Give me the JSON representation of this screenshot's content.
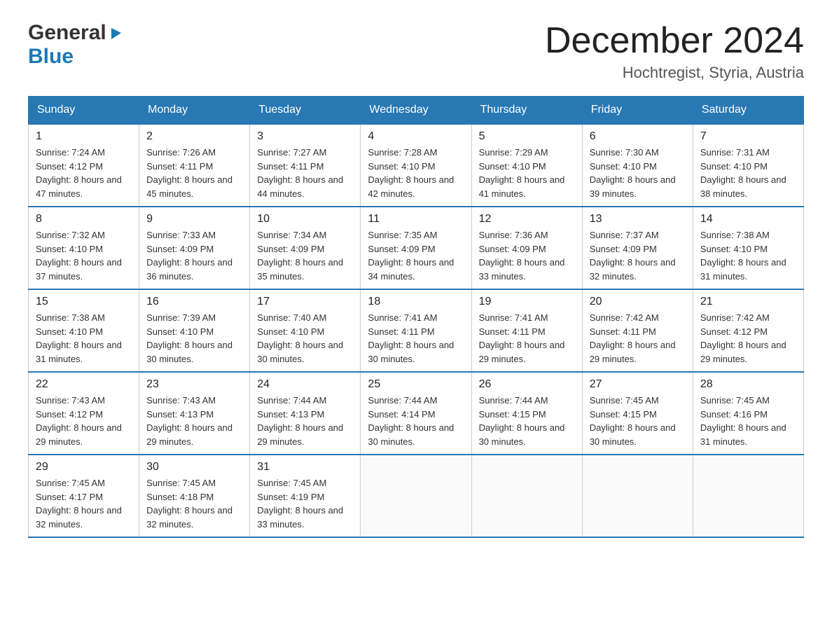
{
  "logo": {
    "general": "General",
    "blue": "Blue",
    "triangle": "▶"
  },
  "title": {
    "month": "December 2024",
    "location": "Hochtregist, Styria, Austria"
  },
  "weekdays": [
    "Sunday",
    "Monday",
    "Tuesday",
    "Wednesday",
    "Thursday",
    "Friday",
    "Saturday"
  ],
  "weeks": [
    [
      {
        "day": "1",
        "sunrise": "7:24 AM",
        "sunset": "4:12 PM",
        "daylight": "8 hours and 47 minutes."
      },
      {
        "day": "2",
        "sunrise": "7:26 AM",
        "sunset": "4:11 PM",
        "daylight": "8 hours and 45 minutes."
      },
      {
        "day": "3",
        "sunrise": "7:27 AM",
        "sunset": "4:11 PM",
        "daylight": "8 hours and 44 minutes."
      },
      {
        "day": "4",
        "sunrise": "7:28 AM",
        "sunset": "4:10 PM",
        "daylight": "8 hours and 42 minutes."
      },
      {
        "day": "5",
        "sunrise": "7:29 AM",
        "sunset": "4:10 PM",
        "daylight": "8 hours and 41 minutes."
      },
      {
        "day": "6",
        "sunrise": "7:30 AM",
        "sunset": "4:10 PM",
        "daylight": "8 hours and 39 minutes."
      },
      {
        "day": "7",
        "sunrise": "7:31 AM",
        "sunset": "4:10 PM",
        "daylight": "8 hours and 38 minutes."
      }
    ],
    [
      {
        "day": "8",
        "sunrise": "7:32 AM",
        "sunset": "4:10 PM",
        "daylight": "8 hours and 37 minutes."
      },
      {
        "day": "9",
        "sunrise": "7:33 AM",
        "sunset": "4:09 PM",
        "daylight": "8 hours and 36 minutes."
      },
      {
        "day": "10",
        "sunrise": "7:34 AM",
        "sunset": "4:09 PM",
        "daylight": "8 hours and 35 minutes."
      },
      {
        "day": "11",
        "sunrise": "7:35 AM",
        "sunset": "4:09 PM",
        "daylight": "8 hours and 34 minutes."
      },
      {
        "day": "12",
        "sunrise": "7:36 AM",
        "sunset": "4:09 PM",
        "daylight": "8 hours and 33 minutes."
      },
      {
        "day": "13",
        "sunrise": "7:37 AM",
        "sunset": "4:09 PM",
        "daylight": "8 hours and 32 minutes."
      },
      {
        "day": "14",
        "sunrise": "7:38 AM",
        "sunset": "4:10 PM",
        "daylight": "8 hours and 31 minutes."
      }
    ],
    [
      {
        "day": "15",
        "sunrise": "7:38 AM",
        "sunset": "4:10 PM",
        "daylight": "8 hours and 31 minutes."
      },
      {
        "day": "16",
        "sunrise": "7:39 AM",
        "sunset": "4:10 PM",
        "daylight": "8 hours and 30 minutes."
      },
      {
        "day": "17",
        "sunrise": "7:40 AM",
        "sunset": "4:10 PM",
        "daylight": "8 hours and 30 minutes."
      },
      {
        "day": "18",
        "sunrise": "7:41 AM",
        "sunset": "4:11 PM",
        "daylight": "8 hours and 30 minutes."
      },
      {
        "day": "19",
        "sunrise": "7:41 AM",
        "sunset": "4:11 PM",
        "daylight": "8 hours and 29 minutes."
      },
      {
        "day": "20",
        "sunrise": "7:42 AM",
        "sunset": "4:11 PM",
        "daylight": "8 hours and 29 minutes."
      },
      {
        "day": "21",
        "sunrise": "7:42 AM",
        "sunset": "4:12 PM",
        "daylight": "8 hours and 29 minutes."
      }
    ],
    [
      {
        "day": "22",
        "sunrise": "7:43 AM",
        "sunset": "4:12 PM",
        "daylight": "8 hours and 29 minutes."
      },
      {
        "day": "23",
        "sunrise": "7:43 AM",
        "sunset": "4:13 PM",
        "daylight": "8 hours and 29 minutes."
      },
      {
        "day": "24",
        "sunrise": "7:44 AM",
        "sunset": "4:13 PM",
        "daylight": "8 hours and 29 minutes."
      },
      {
        "day": "25",
        "sunrise": "7:44 AM",
        "sunset": "4:14 PM",
        "daylight": "8 hours and 30 minutes."
      },
      {
        "day": "26",
        "sunrise": "7:44 AM",
        "sunset": "4:15 PM",
        "daylight": "8 hours and 30 minutes."
      },
      {
        "day": "27",
        "sunrise": "7:45 AM",
        "sunset": "4:15 PM",
        "daylight": "8 hours and 30 minutes."
      },
      {
        "day": "28",
        "sunrise": "7:45 AM",
        "sunset": "4:16 PM",
        "daylight": "8 hours and 31 minutes."
      }
    ],
    [
      {
        "day": "29",
        "sunrise": "7:45 AM",
        "sunset": "4:17 PM",
        "daylight": "8 hours and 32 minutes."
      },
      {
        "day": "30",
        "sunrise": "7:45 AM",
        "sunset": "4:18 PM",
        "daylight": "8 hours and 32 minutes."
      },
      {
        "day": "31",
        "sunrise": "7:45 AM",
        "sunset": "4:19 PM",
        "daylight": "8 hours and 33 minutes."
      },
      null,
      null,
      null,
      null
    ]
  ]
}
